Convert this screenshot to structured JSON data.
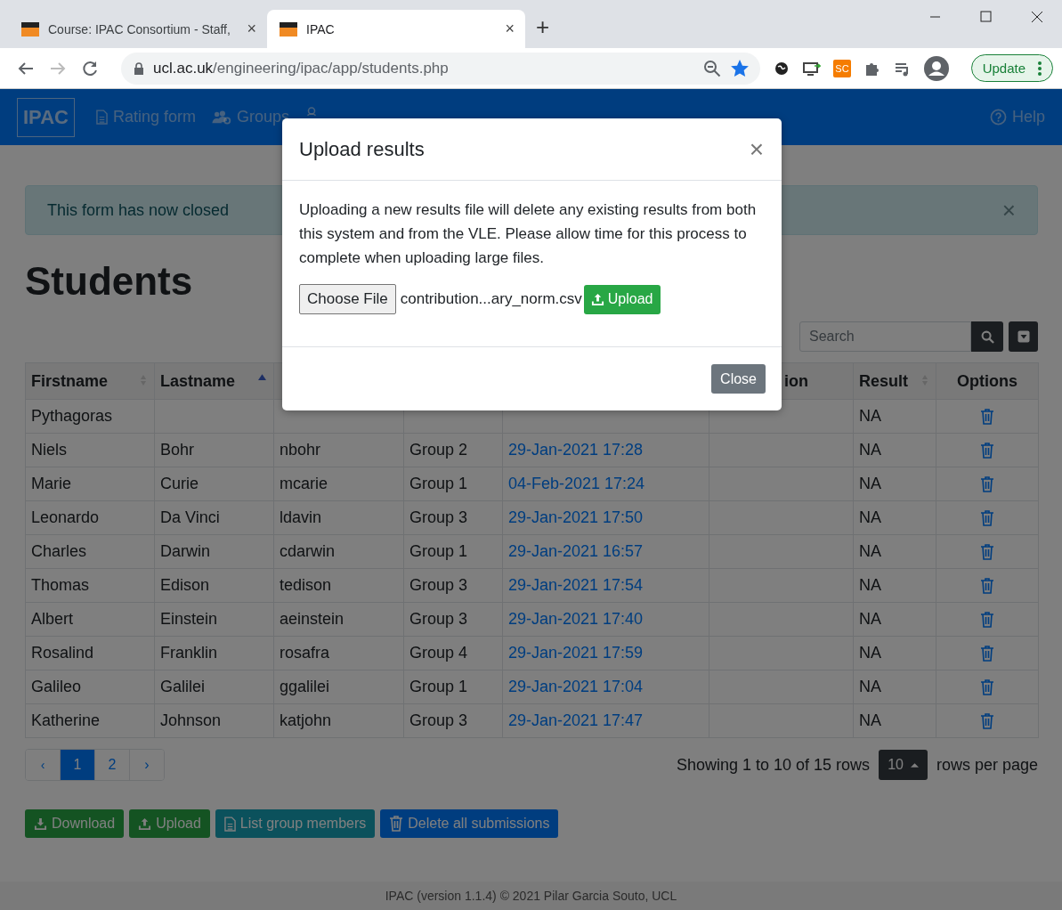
{
  "browser": {
    "tabs": [
      {
        "title": "Course: IPAC Consortium - Staff,",
        "close": "×",
        "selected": false
      },
      {
        "title": "IPAC",
        "close": "×",
        "selected": true
      }
    ],
    "new_tab": "+",
    "url_host": "ucl.ac.uk",
    "url_path": "/engineering/ipac/app/students.php",
    "extension_label": "SC",
    "update_button": "Update"
  },
  "navbar": {
    "brand": "IPAC",
    "items": [
      {
        "label": "Rating form"
      },
      {
        "label": "Groups"
      }
    ],
    "help": "Help"
  },
  "alert": {
    "message": "This form has now closed",
    "close": "×"
  },
  "page_title": "Students",
  "search": {
    "placeholder": "Search"
  },
  "table": {
    "columns": [
      {
        "label": "Firstname",
        "sorted": false
      },
      {
        "label": "Lastname",
        "sorted": true
      },
      {},
      {},
      {},
      {
        "label": "ion"
      },
      {
        "label": "Result",
        "sorted": false
      },
      {
        "label": "Options"
      }
    ],
    "rows": [
      {
        "firstname": "Pythagoras",
        "result": "NA"
      },
      {
        "firstname": "Niels",
        "lastname": "Bohr",
        "username": "nbohr",
        "group": "Group 2",
        "date": "29-Jan-2021 17:28",
        "result": "NA"
      },
      {
        "firstname": "Marie",
        "lastname": "Curie",
        "username": "mcarie",
        "group": "Group 1",
        "date": "04-Feb-2021 17:24",
        "result": "NA"
      },
      {
        "firstname": "Leonardo",
        "lastname": "Da Vinci",
        "username": "ldavin",
        "group": "Group 3",
        "date": "29-Jan-2021 17:50",
        "result": "NA"
      },
      {
        "firstname": "Charles",
        "lastname": "Darwin",
        "username": "cdarwin",
        "group": "Group 1",
        "date": "29-Jan-2021 16:57",
        "result": "NA"
      },
      {
        "firstname": "Thomas",
        "lastname": "Edison",
        "username": "tedison",
        "group": "Group 3",
        "date": "29-Jan-2021 17:54",
        "result": "NA"
      },
      {
        "firstname": "Albert",
        "lastname": "Einstein",
        "username": "aeinstein",
        "group": "Group 3",
        "date": "29-Jan-2021 17:40",
        "result": "NA"
      },
      {
        "firstname": "Rosalind",
        "lastname": "Franklin",
        "username": "rosafra",
        "group": "Group 4",
        "date": "29-Jan-2021 17:59",
        "result": "NA"
      },
      {
        "firstname": "Galileo",
        "lastname": "Galilei",
        "username": "ggalilei",
        "group": "Group 1",
        "date": "29-Jan-2021 17:04",
        "result": "NA"
      },
      {
        "firstname": "Katherine",
        "lastname": "Johnson",
        "username": "katjohn",
        "group": "Group 3",
        "date": "29-Jan-2021 17:47",
        "result": "NA"
      }
    ]
  },
  "pagination": {
    "prev": "‹",
    "pages": [
      {
        "label": "1",
        "selected": true
      },
      {
        "label": "2",
        "selected": false
      }
    ],
    "next": "›",
    "summary": "Showing 1 to 10 of 15 rows",
    "page_size": "10",
    "page_size_suffix": "rows per page"
  },
  "actions": [
    {
      "label": "Download",
      "kind": "download"
    },
    {
      "label": "Upload",
      "kind": "upload"
    },
    {
      "label": "List group members",
      "kind": "list"
    },
    {
      "label": "Delete all submissions",
      "kind": "delete"
    }
  ],
  "footer": "IPAC (version 1.1.4) © 2021 Pilar Garcia Souto, UCL",
  "modal": {
    "title": "Upload results",
    "close": "×",
    "message": "Uploading a new results file will delete any existing results from both this system and from the VLE. Please allow time for this process to complete when uploading large files.",
    "file_button": "Choose File",
    "file_name": "contribution...ary_norm.csv",
    "upload_button": "Upload",
    "close_button": "Close"
  }
}
